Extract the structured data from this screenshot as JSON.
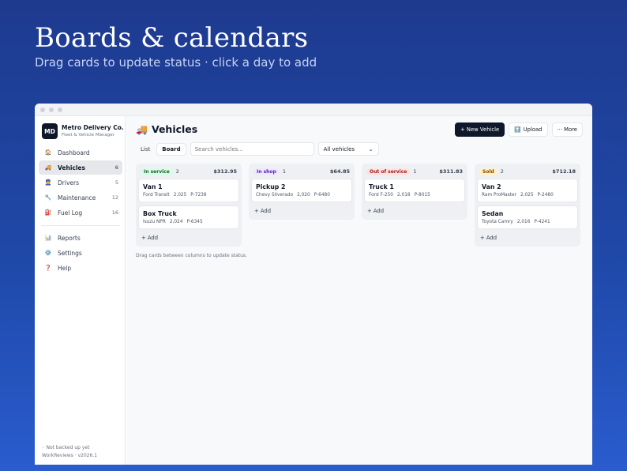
{
  "hero": {
    "title": "Boards & calendars",
    "subtitle": "Drag cards to update status · click a day to add"
  },
  "brand": {
    "logo": "MD",
    "name": "Metro Delivery Co.",
    "subtitle": "Fleet & Vehicle Manager"
  },
  "sidebar": {
    "items": [
      {
        "label": "Dashboard",
        "icon": "🏠",
        "count": ""
      },
      {
        "label": "Vehicles",
        "icon": "🚚",
        "count": "6"
      },
      {
        "label": "Drivers",
        "icon": "👮",
        "count": "5"
      },
      {
        "label": "Maintenance",
        "icon": "🔧",
        "count": "12"
      },
      {
        "label": "Fuel Log",
        "icon": "⛽",
        "count": "16"
      }
    ],
    "secondary": [
      {
        "label": "Reports",
        "icon": "📊"
      },
      {
        "label": "Settings",
        "icon": "⚙️"
      },
      {
        "label": "Help",
        "icon": "❓"
      }
    ],
    "footer_status": "Not backed up yet",
    "footer_version": "WorkReviews · v2026.1"
  },
  "page": {
    "title": "Vehicles",
    "title_icon": "🚚",
    "new_button": "+ New Vehicle",
    "upload_button": "Upload",
    "upload_icon": "⬆️",
    "more_button": "··· More"
  },
  "toolbar": {
    "list_label": "List",
    "board_label": "Board",
    "search_placeholder": "Search vehicles...",
    "filter_value": "All vehicles"
  },
  "columns": [
    {
      "status": "In service",
      "count": "2",
      "total": "$312.95",
      "badge_bg": "#dcfce7",
      "badge_fg": "#166534",
      "cards": [
        {
          "title": "Van 1",
          "model": "Ford Transit",
          "year": "2,025",
          "plate": "P-7238"
        },
        {
          "title": "Box Truck",
          "model": "Isuzu NPR",
          "year": "2,024",
          "plate": "P-6345"
        }
      ]
    },
    {
      "status": "In shop",
      "count": "1",
      "total": "$64.85",
      "badge_bg": "#ede9fe",
      "badge_fg": "#5b21b6",
      "cards": [
        {
          "title": "Pickup 2",
          "model": "Chevy Silverado",
          "year": "2,020",
          "plate": "P-6480"
        }
      ]
    },
    {
      "status": "Out of service",
      "count": "1",
      "total": "$311.83",
      "badge_bg": "#fee2e2",
      "badge_fg": "#991b1b",
      "cards": [
        {
          "title": "Truck 1",
          "model": "Ford F-250",
          "year": "2,018",
          "plate": "P-8015"
        }
      ]
    },
    {
      "status": "Sold",
      "count": "2",
      "total": "$712.18",
      "badge_bg": "#fef3c7",
      "badge_fg": "#92400e",
      "cards": [
        {
          "title": "Van 2",
          "model": "Ram ProMaster",
          "year": "2,025",
          "plate": "P-2480"
        },
        {
          "title": "Sedan",
          "model": "Toyota Camry",
          "year": "2,016",
          "plate": "P-4241"
        }
      ]
    }
  ],
  "add_label": "+ Add",
  "hint": "Drag cards between columns to update status."
}
